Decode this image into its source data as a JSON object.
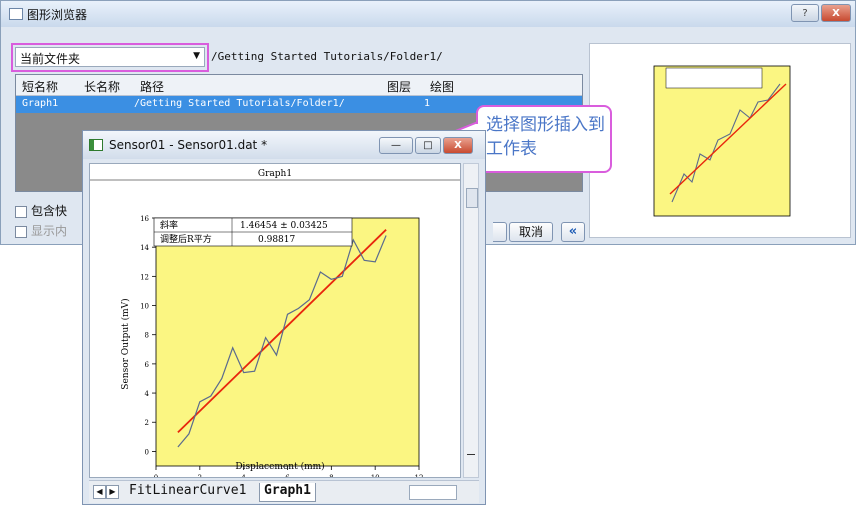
{
  "dialog": {
    "title": "图形浏览器",
    "help_label": "?",
    "close_label": "X",
    "folder_select": "当前文件夹",
    "path": "/Getting Started Tutorials/Folder1/",
    "columns": [
      "短名称",
      "长名称",
      "路径",
      "图层",
      "绘图"
    ],
    "row": {
      "short_name": "Graph1",
      "path": "/Getting Started Tutorials/Folder1/",
      "layers": "1"
    },
    "check_include": "包含快",
    "check_show": "显示内",
    "cancel_label": "取消",
    "collapse_label": "«"
  },
  "callout": {
    "line1": "选择图形插入到",
    "line2": "工作表"
  },
  "window": {
    "title": "Sensor01 - Sensor01.dat *",
    "min_label": "—",
    "max_label": "□",
    "close_label": "X",
    "graph_title": "Graph1",
    "tabs": [
      "FitLinearCurve1",
      "Graph1"
    ]
  },
  "colors": {
    "plot_bg": "#fbf682",
    "fit_line": "#e8260d",
    "data_line": "#5a6b8e",
    "callout_border": "#d95ddd"
  },
  "chart_data": {
    "type": "line",
    "title": "",
    "xlabel": "Displacement (mm)",
    "ylabel": "Sensor Output (mV)",
    "xlim": [
      0,
      12
    ],
    "ylim": [
      -1,
      16
    ],
    "xticks": [
      "0",
      "2",
      "4",
      "6",
      "8",
      "10",
      "12"
    ],
    "yticks": [
      "0",
      "2",
      "4",
      "6",
      "8",
      "10",
      "12",
      "14",
      "16"
    ],
    "series": [
      {
        "x": [
          1,
          1.5,
          2,
          2.5,
          3,
          3.5,
          4,
          4.5,
          5,
          5.5,
          6,
          6.5,
          7,
          7.5,
          8,
          8.5,
          9,
          9.5,
          10,
          10.5
        ],
        "y": [
          0.3,
          1.2,
          3.4,
          3.8,
          5,
          7.1,
          5.4,
          5.5,
          7.8,
          6.6,
          9.4,
          9.8,
          10.4,
          12.3,
          11.8,
          12,
          14.5,
          13.1,
          13,
          14.8
        ]
      },
      {
        "x": [
          1,
          10.5
        ],
        "y": [
          1.3,
          15.2
        ]
      }
    ],
    "stats": {
      "slope_label": "斜率",
      "slope_value": "1.46454 ± 0.03425",
      "r2_label": "调整后R平方",
      "r2_value": "0.98817"
    }
  }
}
